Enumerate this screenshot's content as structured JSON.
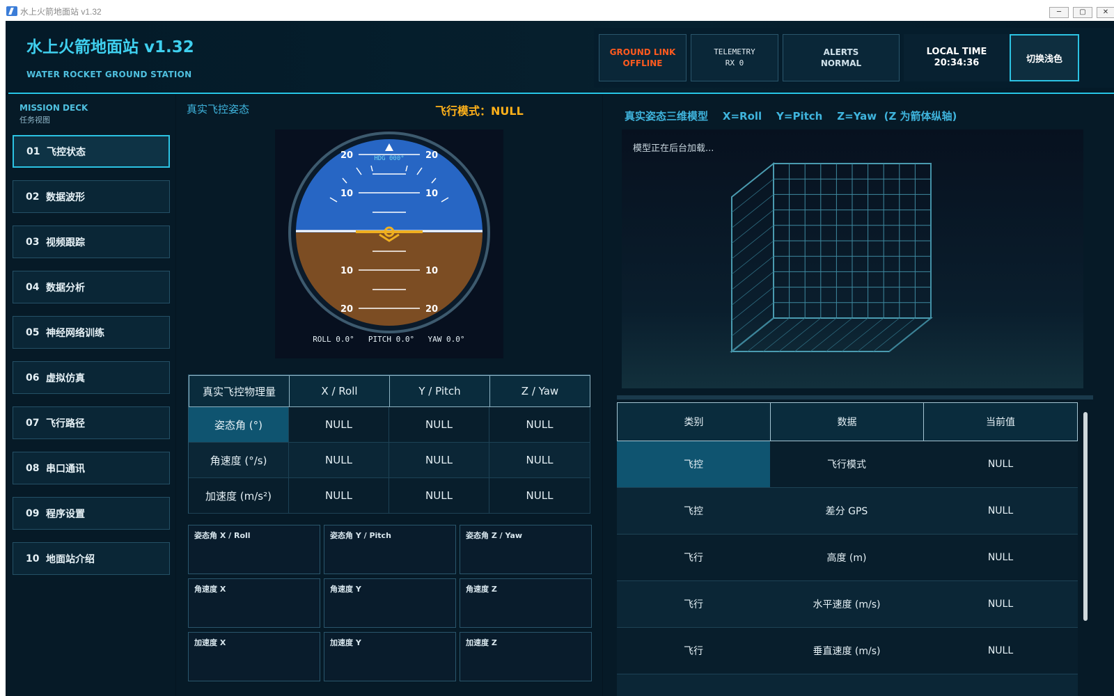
{
  "window": {
    "title": "水上火箭地面站 v1.32",
    "min": "─",
    "max": "▢",
    "close": "✕"
  },
  "header": {
    "title": "水上火箭地面站 v1.32",
    "subtitle": "WATER ROCKET GROUND STATION",
    "ground_link": {
      "line1": "GROUND LINK",
      "line2": "OFFLINE",
      "color": "#ff5a1f"
    },
    "telemetry": {
      "line1": "TELEMETRY",
      "line2": "RX 0"
    },
    "alerts": {
      "line1": "ALERTS",
      "line2": "NORMAL"
    },
    "local_time": {
      "line1": "LOCAL TIME",
      "line2": "20:34:36"
    },
    "theme_button": "切换浅色"
  },
  "sidebar": {
    "title": "MISSION DECK",
    "subtitle": "任务视图",
    "items": [
      {
        "num": "01",
        "label": "飞控状态",
        "active": true
      },
      {
        "num": "02",
        "label": "数据波形"
      },
      {
        "num": "03",
        "label": "视频跟踪"
      },
      {
        "num": "04",
        "label": "数据分析"
      },
      {
        "num": "05",
        "label": "神经网络训练"
      },
      {
        "num": "06",
        "label": "虚拟仿真"
      },
      {
        "num": "07",
        "label": "飞行路径"
      },
      {
        "num": "08",
        "label": "串口通讯"
      },
      {
        "num": "09",
        "label": "程序设置"
      },
      {
        "num": "10",
        "label": "地面站介绍"
      }
    ]
  },
  "attitude": {
    "title": "真实飞控姿态",
    "flight_mode": "飞行模式：NULL",
    "heading": "HDG 000°",
    "roll": "ROLL 0.0°",
    "pitch": "PITCH 0.0°",
    "yaw": "YAW 0.0°",
    "pitch_labels": {
      "p20": "20",
      "p10": "10"
    },
    "sky_color": "#2766c4",
    "ground_color": "#7c4d23",
    "aircraft_color": "#f0b020"
  },
  "phys_table": {
    "headers": [
      "真实飞控物理量",
      "X / Roll",
      "Y / Pitch",
      "Z / Yaw"
    ],
    "rows": [
      {
        "label": "姿态角 (°)",
        "x": "NULL",
        "y": "NULL",
        "z": "NULL"
      },
      {
        "label": "角速度 (°/s)",
        "x": "NULL",
        "y": "NULL",
        "z": "NULL"
      },
      {
        "label": "加速度 (m/s²)",
        "x": "NULL",
        "y": "NULL",
        "z": "NULL"
      }
    ]
  },
  "mini_charts": [
    "姿态角 X / Roll",
    "姿态角 Y / Pitch",
    "姿态角 Z / Yaw",
    "角速度 X",
    "角速度 Y",
    "角速度 Z",
    "加速度 X",
    "加速度 Y",
    "加速度 Z"
  ],
  "model": {
    "title": "真实姿态三维模型    X=Roll    Y=Pitch    Z=Yaw  (Z 为箭体纵轴)",
    "status": "模型正在后台加载..."
  },
  "data_table": {
    "headers": [
      "类别",
      "数据",
      "当前值"
    ],
    "rows": [
      {
        "cat": "飞控",
        "name": "飞行模式",
        "value": "NULL"
      },
      {
        "cat": "飞控",
        "name": "差分 GPS",
        "value": "NULL"
      },
      {
        "cat": "飞行",
        "name": "高度 (m)",
        "value": "NULL"
      },
      {
        "cat": "飞行",
        "name": "水平速度 (m/s)",
        "value": "NULL"
      },
      {
        "cat": "飞行",
        "name": "垂直速度 (m/s)",
        "value": "NULL"
      }
    ]
  }
}
